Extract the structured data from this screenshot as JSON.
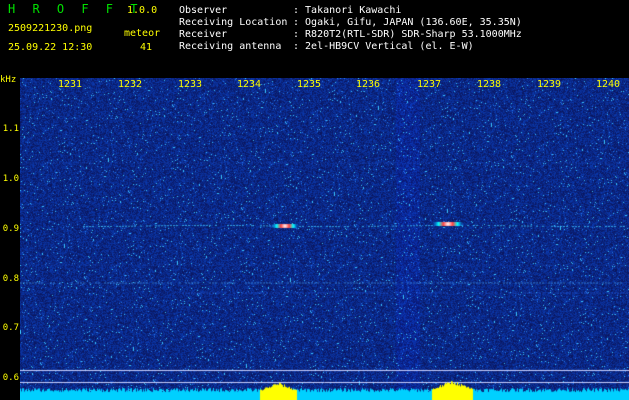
{
  "header": {
    "app_title": "H R O F F T",
    "version": "1.0.0",
    "filename": "2509221230.png",
    "datetime": "25.09.22 12:30",
    "meteor_label": "meteor",
    "meteor_count": "41",
    "observer_label": "Observer",
    "observer_value": ": Takanori Kawachi",
    "location_label": "Receiving Location",
    "location_value": ": Ogaki, Gifu, JAPAN (136.60E, 35.35N)",
    "receiver_label": "Receiver",
    "receiver_value": ": R820T2(RTL-SDR) SDR-Sharp 53.1000MHz",
    "antenna_label": "Receiving antenna",
    "antenna_value": ": 2el-HB9CV Vertical (el. E-W)"
  },
  "y_axis": {
    "unit": "kHz",
    "ticks": [
      "1.1",
      "1.0",
      "0.9",
      "0.8",
      "0.7",
      "0.6"
    ]
  },
  "x_axis": {
    "ticks": [
      "1231",
      "1232",
      "1233",
      "1234",
      "1235",
      "1236",
      "1237",
      "1238",
      "1239",
      "1240"
    ]
  },
  "colors": {
    "background": "#000000",
    "label_yellow": "#ffff00",
    "title_green": "#00e000",
    "noise_blue": "#1a2a9a",
    "signal_cyan": "#00ffff"
  }
}
